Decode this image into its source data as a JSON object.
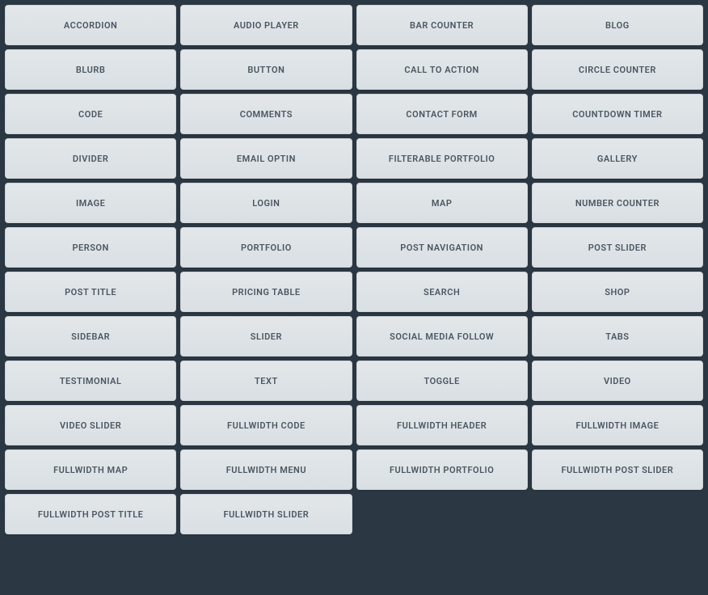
{
  "modules": [
    {
      "id": "accordion",
      "label": "ACCORDION"
    },
    {
      "id": "audio-player",
      "label": "AUDIO PLAYER"
    },
    {
      "id": "bar-counter",
      "label": "BAR COUNTER"
    },
    {
      "id": "blog",
      "label": "BLOG"
    },
    {
      "id": "blurb",
      "label": "BLURB"
    },
    {
      "id": "button",
      "label": "BUTTON"
    },
    {
      "id": "call-to-action",
      "label": "CALL TO ACTION"
    },
    {
      "id": "circle-counter",
      "label": "CIRCLE COUNTER"
    },
    {
      "id": "code",
      "label": "CODE"
    },
    {
      "id": "comments",
      "label": "COMMENTS"
    },
    {
      "id": "contact-form",
      "label": "CONTACT FORM"
    },
    {
      "id": "countdown-timer",
      "label": "COUNTDOWN TIMER"
    },
    {
      "id": "divider",
      "label": "DIVIDER"
    },
    {
      "id": "email-optin",
      "label": "EMAIL OPTIN"
    },
    {
      "id": "filterable-portfolio",
      "label": "FILTERABLE PORTFOLIO"
    },
    {
      "id": "gallery",
      "label": "GALLERY"
    },
    {
      "id": "image",
      "label": "IMAGE"
    },
    {
      "id": "login",
      "label": "LOGIN"
    },
    {
      "id": "map",
      "label": "MAP"
    },
    {
      "id": "number-counter",
      "label": "NUMBER COUNTER"
    },
    {
      "id": "person",
      "label": "PERSON"
    },
    {
      "id": "portfolio",
      "label": "PORTFOLIO"
    },
    {
      "id": "post-navigation",
      "label": "POST NAVIGATION"
    },
    {
      "id": "post-slider",
      "label": "POST SLIDER"
    },
    {
      "id": "post-title",
      "label": "POST TITLE"
    },
    {
      "id": "pricing-table",
      "label": "PRICING TABLE"
    },
    {
      "id": "search",
      "label": "SEARCH"
    },
    {
      "id": "shop",
      "label": "SHOP"
    },
    {
      "id": "sidebar",
      "label": "SIDEBAR"
    },
    {
      "id": "slider",
      "label": "SLIDER"
    },
    {
      "id": "social-media-follow",
      "label": "SOCIAL MEDIA FOLLOW"
    },
    {
      "id": "tabs",
      "label": "TABS"
    },
    {
      "id": "testimonial",
      "label": "TESTIMONIAL"
    },
    {
      "id": "text",
      "label": "TEXT"
    },
    {
      "id": "toggle",
      "label": "TOGGLE"
    },
    {
      "id": "video",
      "label": "VIDEO"
    },
    {
      "id": "video-slider",
      "label": "VIDEO SLIDER"
    },
    {
      "id": "fullwidth-code",
      "label": "FULLWIDTH CODE"
    },
    {
      "id": "fullwidth-header",
      "label": "FULLWIDTH HEADER"
    },
    {
      "id": "fullwidth-image",
      "label": "FULLWIDTH IMAGE"
    },
    {
      "id": "fullwidth-map",
      "label": "FULLWIDTH MAP"
    },
    {
      "id": "fullwidth-menu",
      "label": "FULLWIDTH MENU"
    },
    {
      "id": "fullwidth-portfolio",
      "label": "FULLWIDTH PORTFOLIO"
    },
    {
      "id": "fullwidth-post-slider",
      "label": "FULLWIDTH POST SLIDER"
    },
    {
      "id": "fullwidth-post-title",
      "label": "FULLWIDTH POST TITLE"
    },
    {
      "id": "fullwidth-slider",
      "label": "FULLWIDTH SLIDER"
    }
  ]
}
